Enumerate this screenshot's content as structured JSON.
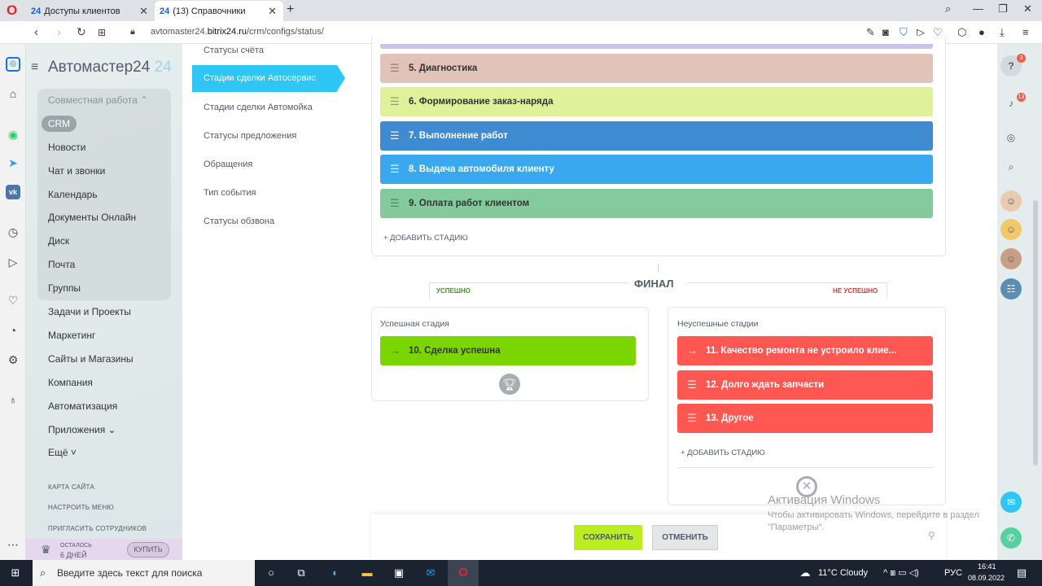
{
  "browser": {
    "tabs": [
      {
        "favicon": "24",
        "title": "Доступы клиентов"
      },
      {
        "favicon": "24",
        "title": "(13) Справочники"
      }
    ],
    "url_prefix": "avtomaster24.",
    "url_host": "bitrix24.ru",
    "url_path": "/crm/configs/status/"
  },
  "b24_menu": {
    "logo": "Автомастер24",
    "logo_suffix": "24",
    "group_header": "Совместная работа ⌃",
    "crm": "CRM",
    "items": [
      "Новости",
      "Чат и звонки",
      "Календарь",
      "Документы Онлайн",
      "Диск",
      "Почта",
      "Группы",
      "Задачи и Проекты",
      "Маркетинг",
      "Сайты и Магазины",
      "Компания",
      "Автоматизация",
      "Приложения ⌄",
      "Ещё ˅"
    ],
    "footer_links": [
      "КАРТА САЙТА",
      "НАСТРОИТЬ МЕНЮ",
      "ПРИГЛАСИТЬ СОТРУДНИКОВ"
    ],
    "trial_top": "ОСТАЛОСЬ",
    "trial_days": "6 ДНЕЙ",
    "buy": "КУПИТЬ"
  },
  "settings_nav": {
    "items": [
      "Статусы счёта",
      "Стадии сделки Автосервис",
      "Стадии сделки Автомойка",
      "Статусы предложения",
      "Обращения",
      "Тип события",
      "Статусы обзвона"
    ],
    "active_index": 1
  },
  "stages": [
    {
      "label": "5. Диагностика",
      "color": "#e2c3b8",
      "white": false
    },
    {
      "label": "6. Формирование заказ-наряда",
      "color": "#dff29a",
      "white": false
    },
    {
      "label": "7. Выполнение работ",
      "color": "#3f8bd1",
      "white": true
    },
    {
      "label": "8. Выдача автомобиля клиенту",
      "color": "#39a8ef",
      "white": true
    },
    {
      "label": "9. Оплата работ клиентом",
      "color": "#83cb9c",
      "white": false
    }
  ],
  "add_stage": "+ ДОБАВИТЬ СТАДИЮ",
  "final": {
    "title": "ФИНАЛ",
    "success_tab": "УСПЕШНО",
    "fail_tab": "НЕ УСПЕШНО",
    "success_title": "Успешная стадия",
    "success_stage": "10. Сделка успешна",
    "success_color": "#7bd500",
    "fail_title": "Неуспешные стадии",
    "fail_stages": [
      "11. Качество ремонта не устроило клие...",
      "12. Долго ждать запчасти",
      "13. Другое"
    ],
    "fail_color": "#ff5752"
  },
  "buttons": {
    "save": "СОХРАНИТЬ",
    "cancel": "ОТМЕНИТЬ"
  },
  "right_sidebar": {
    "help_badge": "3",
    "notif_badge": "13"
  },
  "watermark": {
    "title": "Активация Windows",
    "text": "Чтобы активировать Windows, перейдите в раздел \"Параметры\"."
  },
  "taskbar": {
    "search_placeholder": "Введите здесь текст для поиска",
    "weather": "11°C  Cloudy",
    "lang": "РУС",
    "time": "16:41",
    "date": "08.09.2022"
  }
}
